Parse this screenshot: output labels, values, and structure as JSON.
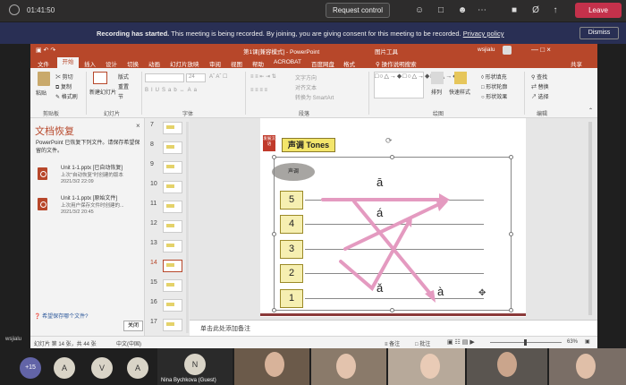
{
  "teams": {
    "timer": "01:41:50",
    "request_control": "Request control",
    "leave": "Leave",
    "banner_bold": "Recording has started.",
    "banner_text": "This meeting is being recorded. By joining, you are giving consent for this meeting to be recorded.",
    "privacy_link": "Privacy policy",
    "dismiss": "Dismiss",
    "presenter_label": "wsjialu"
  },
  "ppt": {
    "title": "第1课[兼容模式] - PowerPoint",
    "picture_tools": "图片工具",
    "user": "wsjialu",
    "tabs": [
      "文件",
      "开始",
      "插入",
      "设计",
      "切换",
      "动画",
      "幻灯片放映",
      "审阅",
      "视图",
      "帮助",
      "ACROBAT",
      "百度网盘",
      "格式"
    ],
    "tell_me": "操作说明搜索",
    "share": "共享",
    "ribbon": {
      "paste": "粘贴",
      "cut": "剪切",
      "copy": "复制",
      "format_painter": "格式刷",
      "clipboard_group": "剪贴板",
      "new_slide": "新建幻灯片",
      "layout": "版式",
      "reset": "重置",
      "section": "节",
      "slides_group": "幻灯片",
      "font_size": "24",
      "font_group": "字体",
      "text_direction": "文字方向",
      "align_text": "对齐文本",
      "smartart": "转换为 SmartArt",
      "paragraph_group": "段落",
      "arrange": "排列",
      "quick_styles": "快速样式",
      "shape_fill": "形状填充",
      "shape_outline": "形状轮廓",
      "shape_effects": "形状效果",
      "drawing_group": "绘图",
      "find": "查找",
      "replace": "替换",
      "select": "选择",
      "editing_group": "编辑"
    },
    "recovery": {
      "title": "文档恢复",
      "desc": "PowerPoint 已恢复下列文件。请保存希望保留的文件。",
      "files": [
        {
          "name": "Unit 1-1.pptx  [已自动恢复]",
          "sub": "上次\"自动恢复\"时创建的版本",
          "date": "2021/3/2 22:09"
        },
        {
          "name": "Unit 1-1.pptx  [原始文件]",
          "sub": "上次用户保存文件时创建的...",
          "date": "2021/3/2 20:45"
        }
      ],
      "question": "希望保存哪个文件?",
      "close": "关闭"
    },
    "thumb_numbers": [
      "7",
      "8",
      "9",
      "10",
      "11",
      "12",
      "13",
      "14",
      "15",
      "16",
      "17"
    ],
    "notes_placeholder": "单击此处添加备注",
    "status_left": "幻灯片 第 14 张，共 44 张",
    "status_lang": "中文(中国)",
    "status_notes": "备注",
    "status_comments": "批注",
    "zoom": "63%"
  },
  "slide": {
    "logo": "发展汉语",
    "title": "声调 Tones",
    "tone_label": "声调",
    "levels": [
      "5",
      "4",
      "3",
      "2",
      "1"
    ],
    "pinyin": [
      "ā",
      "á",
      "ǎ",
      "à"
    ]
  },
  "gallery": {
    "overflow": "+15",
    "avatars": [
      "A",
      "V",
      "A",
      "N"
    ],
    "names": [
      "Nina Bychkova (Guest)",
      "",
      "",
      "",
      "",
      "",
      ""
    ]
  }
}
